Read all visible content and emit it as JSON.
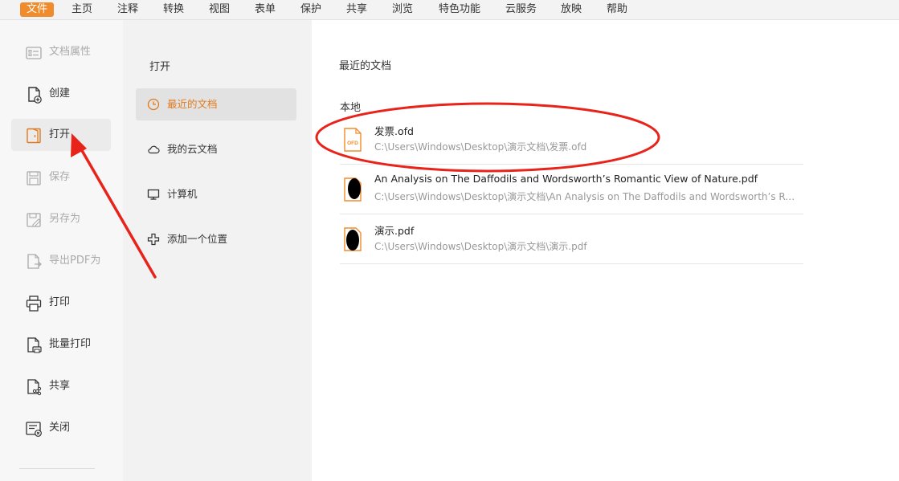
{
  "menubar": {
    "items": [
      {
        "label": "文件",
        "active": true
      },
      {
        "label": "主页"
      },
      {
        "label": "注释"
      },
      {
        "label": "转换"
      },
      {
        "label": "视图"
      },
      {
        "label": "表单"
      },
      {
        "label": "保护"
      },
      {
        "label": "共享"
      },
      {
        "label": "浏览"
      },
      {
        "label": "特色功能"
      },
      {
        "label": "云服务"
      },
      {
        "label": "放映"
      },
      {
        "label": "帮助"
      }
    ]
  },
  "left_panel": {
    "items": [
      {
        "label": "文档属性",
        "icon": "document-properties-icon",
        "disabled": true
      },
      {
        "label": "创建",
        "icon": "create-document-icon"
      },
      {
        "label": "打开",
        "icon": "open-folder-icon",
        "active": true
      },
      {
        "label": "保存",
        "icon": "save-icon",
        "disabled": true
      },
      {
        "label": "另存为",
        "icon": "save-as-icon",
        "disabled": true
      },
      {
        "label": "导出PDF为",
        "icon": "export-pdf-icon",
        "disabled": true
      },
      {
        "label": "打印",
        "icon": "printer-icon"
      },
      {
        "label": "批量打印",
        "icon": "batch-print-icon"
      },
      {
        "label": "共享",
        "icon": "share-icon"
      },
      {
        "label": "关闭",
        "icon": "close-document-icon"
      }
    ]
  },
  "middle_panel": {
    "title": "打开",
    "items": [
      {
        "label": "最近的文档",
        "icon": "clock-icon",
        "active": true
      },
      {
        "label": "我的云文档",
        "icon": "cloud-icon"
      },
      {
        "label": "计算机",
        "icon": "computer-icon"
      },
      {
        "label": "添加一个位置",
        "icon": "plus-icon"
      }
    ]
  },
  "recent": {
    "title": "最近的文档",
    "section": "本地",
    "files": [
      {
        "name": "发票.ofd",
        "path": "C:\\Users\\Windows\\Desktop\\演示文档\\发票.ofd",
        "icon": "ofd-file-icon",
        "icon_text": "OFD"
      },
      {
        "name": "An Analysis on The Daffodils and Wordsworth’s Romantic View of Nature.pdf",
        "path": "C:\\Users\\Windows\\Desktop\\演示文档\\An Analysis on The Daffodils and Wordsworth’s Romantic View of Nature.pdf",
        "icon": "pdf-file-icon"
      },
      {
        "name": "演示.pdf",
        "path": "C:\\Users\\Windows\\Desktop\\演示文档\\演示.pdf",
        "icon": "pdf-file-icon"
      }
    ]
  },
  "colors": {
    "accent": "#f08c2b",
    "annotation": "#e8231a"
  }
}
